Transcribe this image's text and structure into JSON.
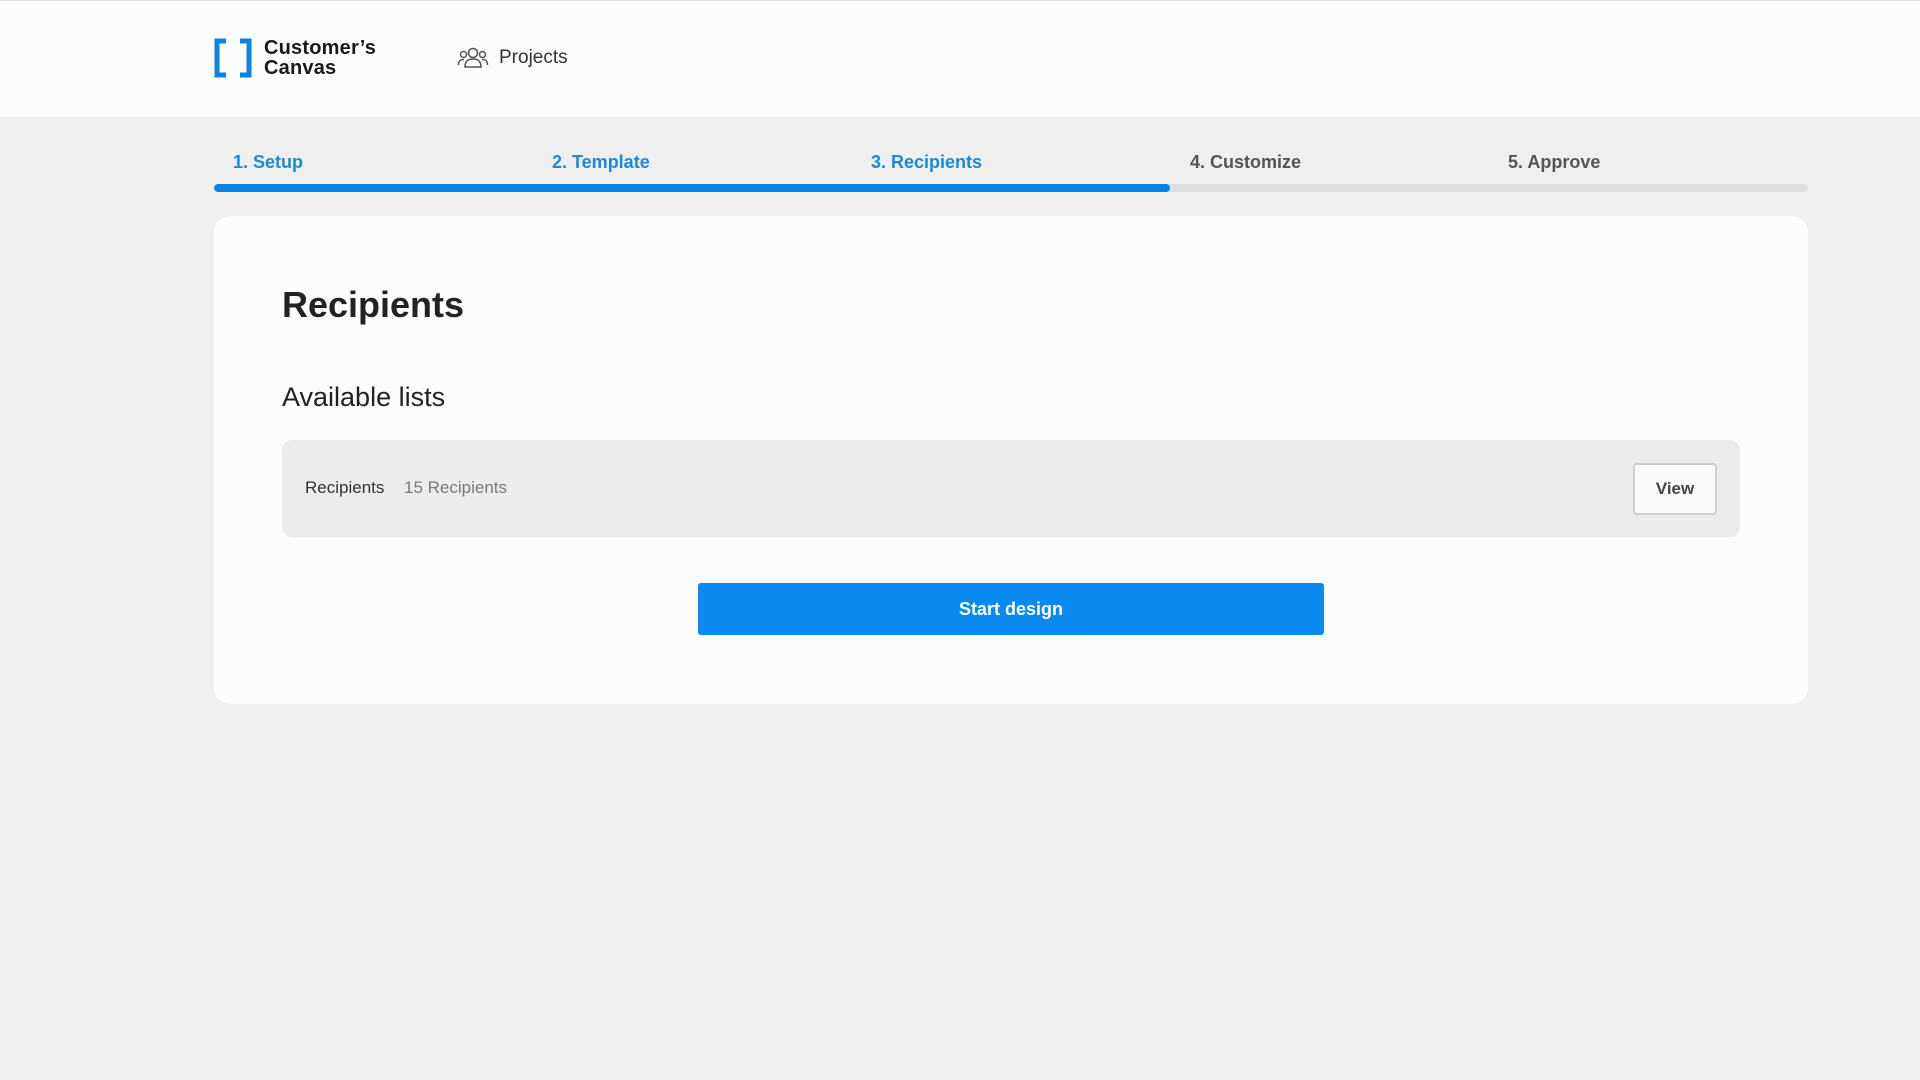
{
  "brand": {
    "name_line1": "Customer’s",
    "name_line2": "Canvas",
    "logo_icon": "bracket-logo-icon",
    "accent_color": "#0a84e0"
  },
  "nav": {
    "projects_label": "Projects",
    "projects_icon": "users-group-icon"
  },
  "stepper": {
    "steps": [
      {
        "label": "1. Setup",
        "state": "complete"
      },
      {
        "label": "2. Template",
        "state": "complete"
      },
      {
        "label": "3. Recipients",
        "state": "current"
      },
      {
        "label": "4. Customize",
        "state": "upcoming"
      },
      {
        "label": "5. Approve",
        "state": "upcoming"
      }
    ],
    "progress_fraction": 0.6
  },
  "main": {
    "title": "Recipients",
    "section_title": "Available lists",
    "lists": [
      {
        "name": "Recipients",
        "count": "15 Recipients",
        "action_label": "View"
      }
    ],
    "primary_button_label": "Start design"
  },
  "colors": {
    "step_active": "#1a8ad6",
    "step_inactive": "#555555",
    "primary_button": "#0a8af0"
  }
}
